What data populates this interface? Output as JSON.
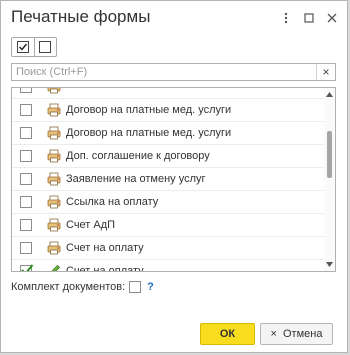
{
  "window": {
    "title": "Печатные формы"
  },
  "toolbar": {
    "check_all_glyph": "☑",
    "uncheck_all_glyph": "☐"
  },
  "search": {
    "placeholder": "Поиск (Ctrl+F)",
    "value": "",
    "clear_glyph": "×"
  },
  "list": {
    "items": [
      {
        "label": "",
        "checked": false,
        "icon": "print-form-icon"
      },
      {
        "label": "Договор на платные мед. услуги",
        "checked": false,
        "icon": "print-form-icon"
      },
      {
        "label": "Договор на платные мед. услуги",
        "checked": false,
        "icon": "print-form-icon"
      },
      {
        "label": "Доп. соглашение к договору",
        "checked": false,
        "icon": "print-form-icon"
      },
      {
        "label": "Заявление на отмену услуг",
        "checked": false,
        "icon": "print-form-icon"
      },
      {
        "label": "Ссылка на оплату",
        "checked": false,
        "icon": "print-form-icon"
      },
      {
        "label": "Счет АдП",
        "checked": false,
        "icon": "print-form-icon"
      },
      {
        "label": "Счет на оплату",
        "checked": false,
        "icon": "print-form-icon"
      },
      {
        "label": "Счет на оплату",
        "checked": true,
        "icon": "pencil-icon"
      }
    ]
  },
  "options": {
    "document_kit_label": "Комплект документов:",
    "document_kit_checked": false,
    "help_glyph": "?"
  },
  "buttons": {
    "ok_label": "ОК",
    "cancel_label": "Отмена",
    "cancel_glyph": "×"
  },
  "colors": {
    "accent_ok": "#f7dd1e",
    "check_green": "#2e8b1f",
    "help_blue": "#1a6fc4"
  }
}
